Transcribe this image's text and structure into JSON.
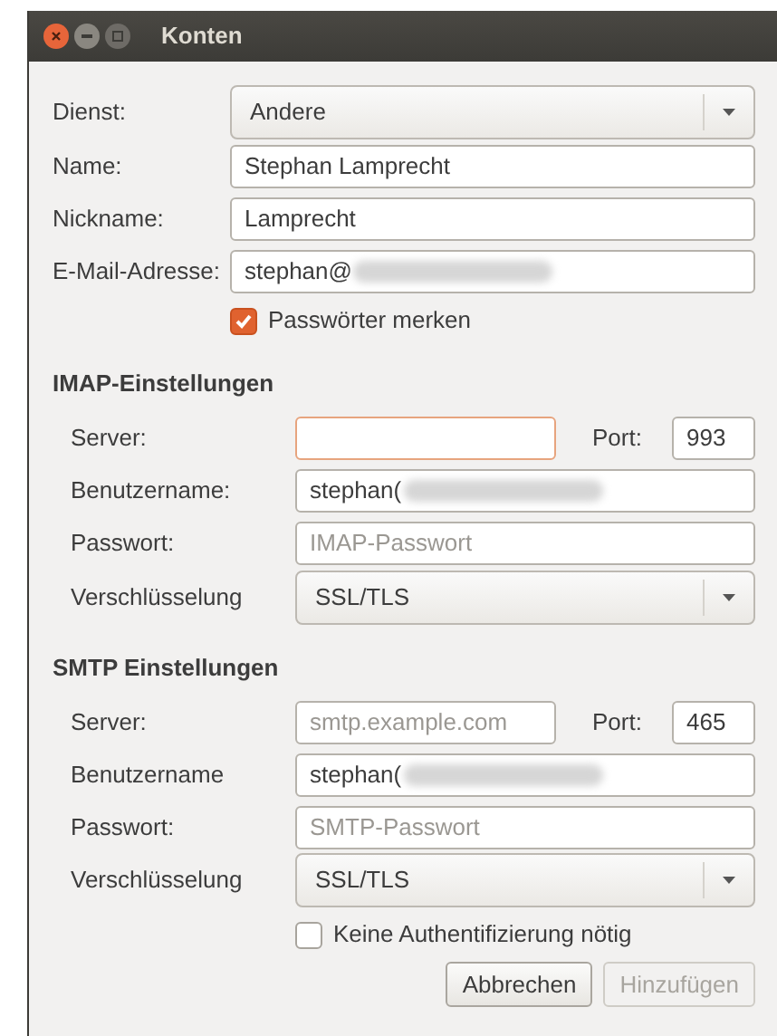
{
  "window": {
    "title": "Konten"
  },
  "account": [
    {
      "kind": "dropdown",
      "label": "Dienst:",
      "value": "Andere"
    },
    {
      "kind": "text",
      "label": "Name:",
      "value": "Stephan Lamprecht"
    },
    {
      "kind": "text",
      "label": "Nickname:",
      "value": "Lamprecht"
    },
    {
      "kind": "text",
      "label": "E-Mail-Adresse:",
      "value": "stephan@",
      "redacted": true
    }
  ],
  "remember_passwords": {
    "label": "Passwörter merken",
    "checked": true
  },
  "sections": [
    {
      "title": "IMAP-Einstellungen",
      "rows": [
        {
          "kind": "server",
          "label": "Server:",
          "value": "",
          "focused": true,
          "port_label": "Port:",
          "port": "993"
        },
        {
          "kind": "text",
          "label": "Benutzername:",
          "value": "stephan(",
          "redacted": true
        },
        {
          "kind": "text",
          "label": "Passwort:",
          "placeholder": "IMAP-Passwort"
        },
        {
          "kind": "dropdown",
          "label": "Verschlüsselung",
          "value": "SSL/TLS"
        }
      ]
    },
    {
      "title": "SMTP Einstellungen",
      "rows": [
        {
          "kind": "server",
          "label": "Server:",
          "placeholder": "smtp.example.com",
          "focused": false,
          "port_label": "Port:",
          "port": "465"
        },
        {
          "kind": "text",
          "label": "Benutzername",
          "value": "stephan(",
          "redacted": true
        },
        {
          "kind": "text",
          "label": "Passwort:",
          "placeholder": "SMTP-Passwort"
        },
        {
          "kind": "dropdown",
          "label": "Verschlüsselung",
          "value": "SSL/TLS"
        }
      ]
    }
  ],
  "no_auth": {
    "label": "Keine Authentifizierung nötig",
    "checked": false
  },
  "buttons": [
    {
      "label": "Abbrechen",
      "disabled": false
    },
    {
      "label": "Hinzufügen",
      "disabled": true
    }
  ]
}
